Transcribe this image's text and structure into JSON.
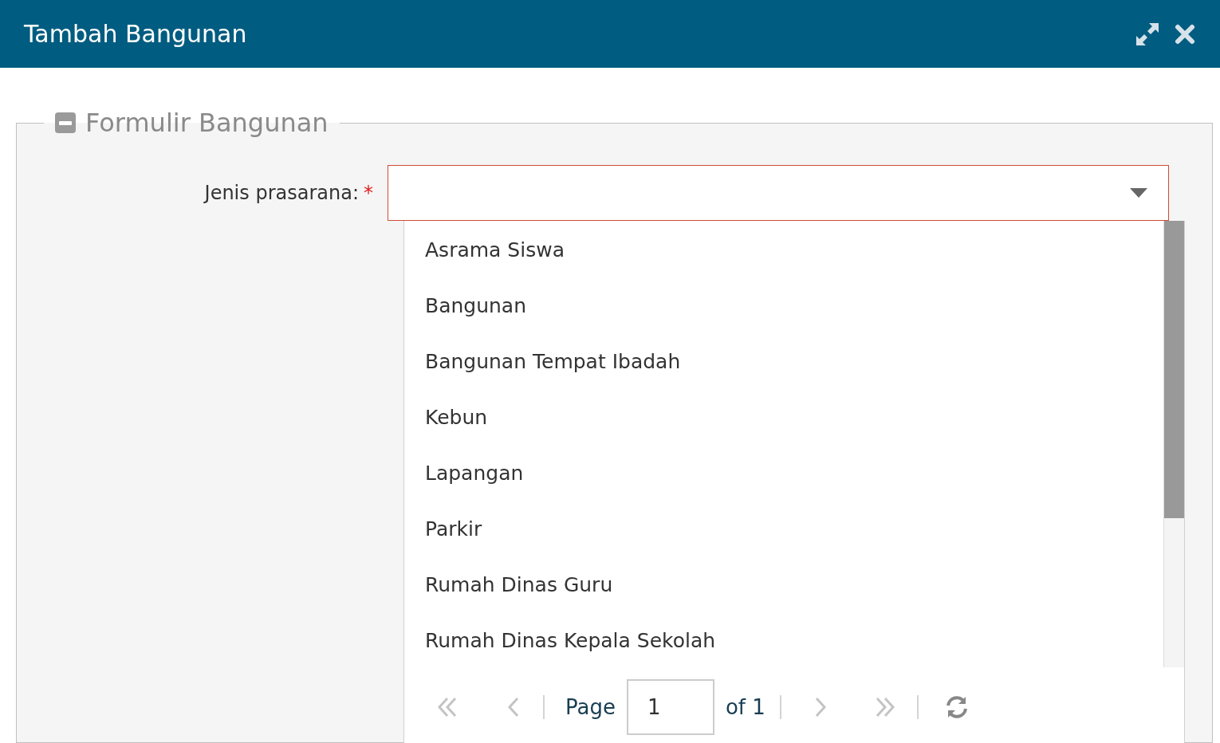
{
  "window": {
    "title": "Tambah Bangunan"
  },
  "form": {
    "legend": "Formulir Bangunan",
    "collapsed": false,
    "field": {
      "label": "Jenis prasarana:",
      "required": true,
      "required_mark": "*",
      "invalid": true
    },
    "dropdown": {
      "expanded": true,
      "options": [
        {
          "label": "Asrama Siswa",
          "selected": false
        },
        {
          "label": "Bangunan",
          "selected": false
        },
        {
          "label": "Bangunan Tempat Ibadah",
          "selected": false
        },
        {
          "label": "Kebun",
          "selected": false
        },
        {
          "label": "Lapangan",
          "selected": false
        },
        {
          "label": "Parkir",
          "selected": false
        },
        {
          "label": "Rumah Dinas Guru",
          "selected": false
        },
        {
          "label": "Rumah Dinas Kepala Sekolah",
          "selected": false
        }
      ],
      "pager": {
        "first_disabled": true,
        "prev_disabled": true,
        "page_label": "Page",
        "page": "1",
        "of_label": "of 1",
        "next_disabled": true,
        "last_disabled": true
      }
    }
  }
}
